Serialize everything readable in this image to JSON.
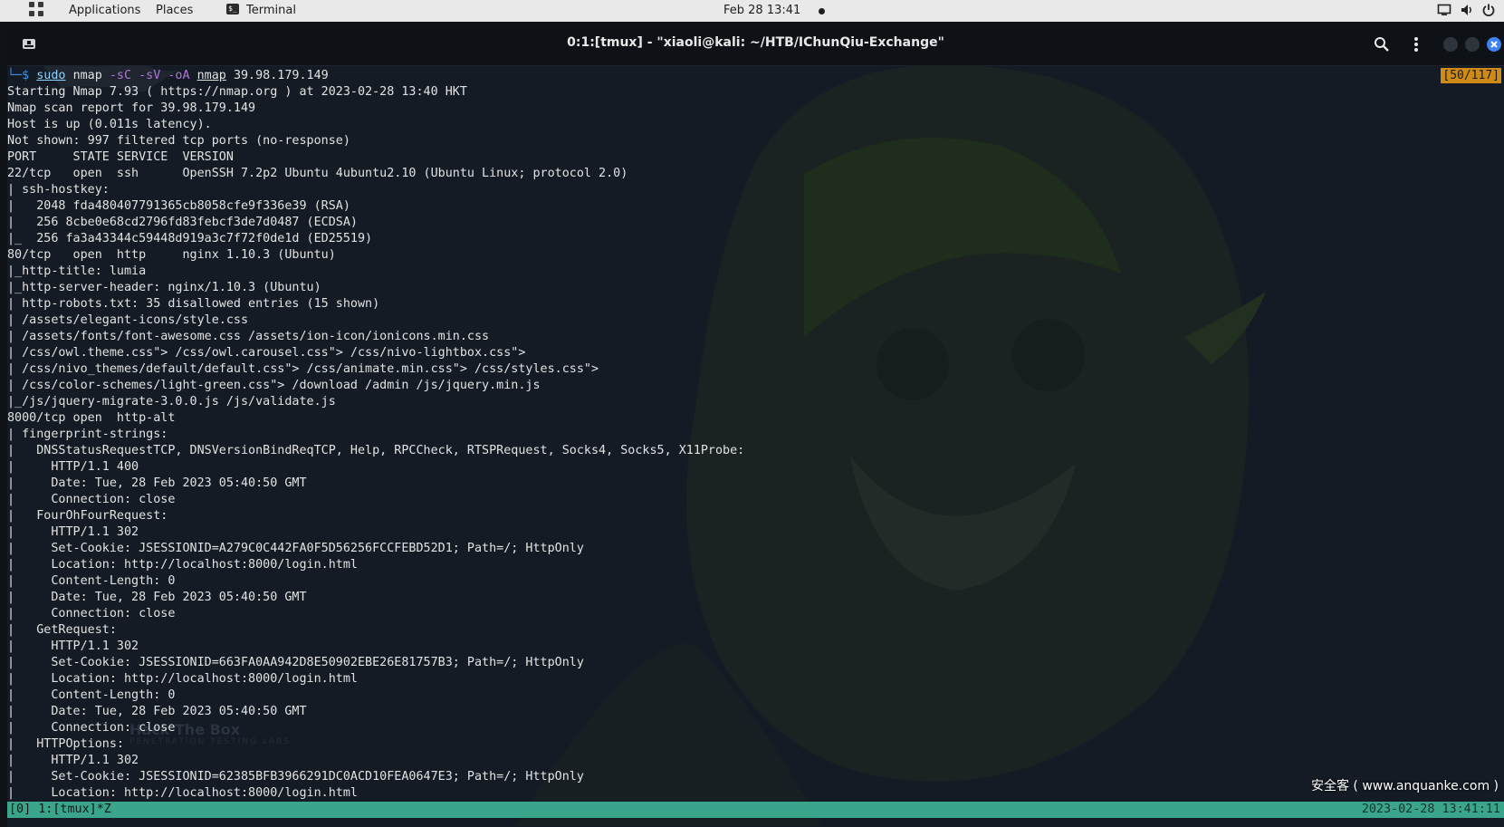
{
  "topbar": {
    "applications": "Applications",
    "places": "Places",
    "terminal": "Terminal",
    "clock": "Feb 28  13:41",
    "icons": [
      "apps-grid-icon",
      "terminal-icon",
      "screen-icon",
      "volume-icon",
      "power-icon"
    ]
  },
  "window": {
    "title": "0:1:[tmux] - \"xiaoli@kali: ~/HTB/IChunQiu-Exchange\""
  },
  "prompt": {
    "corner": "└─$ ",
    "sudo": "sudo",
    "nmap": "nmap",
    "flag_sC": "-sC",
    "flag_sV": "-sV",
    "flag_oA": "-oA",
    "outname": "nmap",
    "target": "39.98.179.149"
  },
  "position_indicator": "[50/117]",
  "output": [
    "Starting Nmap 7.93 ( https://nmap.org ) at 2023-02-28 13:40 HKT",
    "Nmap scan report for 39.98.179.149",
    "Host is up (0.011s latency).",
    "Not shown: 997 filtered tcp ports (no-response)",
    "PORT     STATE SERVICE  VERSION",
    "22/tcp   open  ssh      OpenSSH 7.2p2 Ubuntu 4ubuntu2.10 (Ubuntu Linux; protocol 2.0)",
    "| ssh-hostkey:",
    "|   2048 fda480407791365cb8058cfe9f336e39 (RSA)",
    "|   256 8cbe0e68cd2796fd83febcf3de7d0487 (ECDSA)",
    "|_  256 fa3a43344c59448d919a3c7f72f0de1d (ED25519)",
    "80/tcp   open  http     nginx 1.10.3 (Ubuntu)",
    "|_http-title: lumia",
    "|_http-server-header: nginx/1.10.3 (Ubuntu)",
    "| http-robots.txt: 35 disallowed entries (15 shown)",
    "| /assets/elegant-icons/style.css",
    "| /assets/fonts/font-awesome.css /assets/ion-icon/ionicons.min.css",
    "| /css/owl.theme.css\"> /css/owl.carousel.css\"> /css/nivo-lightbox.css\">",
    "| /css/nivo_themes/default/default.css\"> /css/animate.min.css\"> /css/styles.css\">",
    "| /css/color-schemes/light-green.css\"> /download /admin /js/jquery.min.js",
    "|_/js/jquery-migrate-3.0.0.js /js/validate.js",
    "8000/tcp open  http-alt",
    "| fingerprint-strings:",
    "|   DNSStatusRequestTCP, DNSVersionBindReqTCP, Help, RPCCheck, RTSPRequest, Socks4, Socks5, X11Probe:",
    "|     HTTP/1.1 400",
    "|     Date: Tue, 28 Feb 2023 05:40:50 GMT",
    "|     Connection: close",
    "|   FourOhFourRequest:",
    "|     HTTP/1.1 302",
    "|     Set-Cookie: JSESSIONID=A279C0C442FA0F5D56256FCCFEBD52D1; Path=/; HttpOnly",
    "|     Location: http://localhost:8000/login.html",
    "|     Content-Length: 0",
    "|     Date: Tue, 28 Feb 2023 05:40:50 GMT",
    "|     Connection: close",
    "|   GetRequest:",
    "|     HTTP/1.1 302",
    "|     Set-Cookie: JSESSIONID=663FA0AA942D8E50902EBE26E81757B3; Path=/; HttpOnly",
    "|     Location: http://localhost:8000/login.html",
    "|     Content-Length: 0",
    "|     Date: Tue, 28 Feb 2023 05:40:50 GMT",
    "|     Connection: close",
    "|   HTTPOptions:",
    "|     HTTP/1.1 302",
    "|     Set-Cookie: JSESSIONID=62385BFB3966291DC0ACD10FEA0647E3; Path=/; HttpOnly",
    "|     Location: http://localhost:8000/login.html"
  ],
  "statusbar": {
    "left": "[0] 1:[tmux]*Z",
    "right": "2023-02-28 13:41:11"
  },
  "watermark": "安全客 ( www.anquanke.com )",
  "background": {
    "logo_text": "Hack The Box",
    "logo_subtext": "PENETRATION TESTING LABS"
  },
  "colors": {
    "terminal_bg": "#141b24",
    "status_bar": "#3aa58a",
    "position_badge": "#d08b17",
    "prompt_corner": "#3d8fdc",
    "flag_color": "#b077d8",
    "close_button": "#3b82f6"
  }
}
